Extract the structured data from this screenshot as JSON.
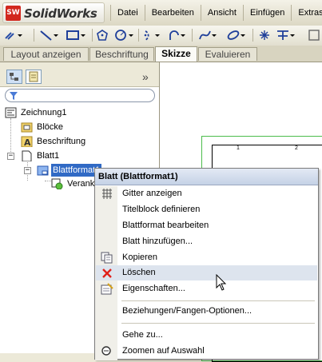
{
  "app": {
    "logo_mark": "SW",
    "logo_text": "SolidWorks"
  },
  "menu": [
    "Datei",
    "Bearbeiten",
    "Ansicht",
    "Einfügen",
    "Extras"
  ],
  "toolbar": {
    "icons": [
      "smart-dimension-icon",
      "line-icon",
      "rectangle-icon",
      "polygon-icon",
      "circle-icon",
      "centerpoint-arc-icon",
      "tangent-arc-icon",
      "spline-icon",
      "ellipse-icon",
      "point-icon",
      "centerline-icon",
      "sketch-fillet-icon"
    ]
  },
  "tabs": [
    "Layout anzeigen",
    "Beschriftung",
    "Skizze",
    "Evaluieren"
  ],
  "active_tab": "Skizze",
  "tree": {
    "root": "Zeichnung1",
    "items": [
      "Blöcke",
      "Beschriftung",
      "Blatt1",
      "Blattformat1",
      "Veranker"
    ]
  },
  "drawing": {
    "zone_numbers": [
      "1",
      "2"
    ]
  },
  "context_menu": {
    "title": "Blatt (Blattformat1)",
    "items": [
      "Gitter anzeigen",
      "Titelblock definieren",
      "Blattformat bearbeiten",
      "Blatt hinzufügen...",
      "Kopieren",
      "Löschen",
      "Eigenschaften...",
      "Beziehungen/Fangen-Optionen...",
      "Gehe zu...",
      "Zoomen auf Auswahl"
    ],
    "hovered_item": "Löschen"
  },
  "colors": {
    "menu_header": "#c5d2e6",
    "selection": "#316ac5",
    "delete_icon": "#e0201a",
    "sheet_border": "#4cbc4c"
  }
}
